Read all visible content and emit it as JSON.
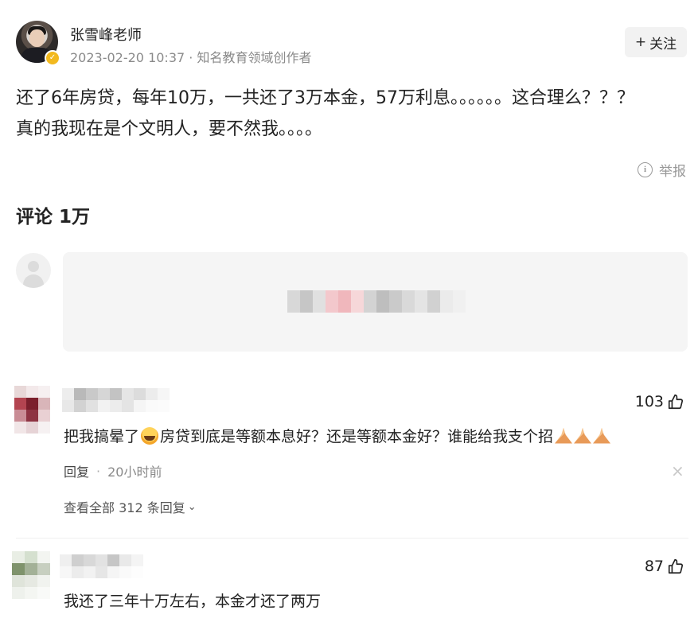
{
  "author": {
    "name": "张雪峰老师",
    "meta": "2023-02-20 10:37 · 知名教育领域创作者"
  },
  "follow_button": {
    "plus": "+",
    "label": "关注"
  },
  "post": {
    "text": "还了6年房贷，每年10万，一共还了3万本金，57万利息。。。。。。这合理么？？？\n真的我现在是个文明人，要不然我。。。。"
  },
  "report": {
    "label": "举报"
  },
  "comments": {
    "title": "评论 1万",
    "items": [
      {
        "likes": "103",
        "text_before_emoji": "把我搞晕了",
        "text_after_emoji": "房贷到底是等额本息好？还是等额本金好？谁能给我支个招",
        "reply_label": "回复",
        "separator": "·",
        "time": "20小时前",
        "view_replies": "查看全部 312 条回复"
      },
      {
        "likes": "87",
        "text": "我还了三年十万左右，本金才还了两万"
      }
    ]
  },
  "colors": {
    "pixel_avatar_1": [
      "#e8d8d8",
      "#f3e9ea",
      "#f6f0f1",
      "#b34450",
      "#7b1f2c",
      "#d9b5b9",
      "#c98c95",
      "#8e3342",
      "#e9d0d3",
      "#f1e6e7",
      "#e6d3d6",
      "#f6f1f2"
    ],
    "pixel_user_1": [
      "#ededed",
      "#b9b9b9",
      "#c9c9c9",
      "#d6d6d6",
      "#c3c3c3",
      "#e5e5e5",
      "#dcdcdc",
      "#ececec",
      "#f6f6f6",
      "#e8e8e8",
      "#d2d2d2",
      "#e1e1e1",
      "#f2f2f2",
      "#ececec",
      "#e4e4e4",
      "#f5f5f5",
      "#fafafa",
      "#fbfbfb"
    ],
    "pixel_input": [
      "#d8d8d8",
      "#c6c6c6",
      "#e0e0e0",
      "#f3c8cc",
      "#f0b7bc",
      "#f6d7d9",
      "#d3d3d3",
      "#bebebe",
      "#cacaca",
      "#d9d9d9",
      "#e4e4e4",
      "#d1d1d1",
      "#ebebeb",
      "#f0f0f0"
    ],
    "pixel_avatar_2": [
      "#e9eee5",
      "#d5e0cf",
      "#f3f5f1",
      "#7f936c",
      "#a3b197",
      "#c7cfc0",
      "#dfe4da",
      "#e6e9e2",
      "#f1f3ef",
      "#eef1ec",
      "#f4f6f2",
      "#f9faf8"
    ],
    "pixel_user_2": [
      "#efefef",
      "#cfcfcf",
      "#d8d8d8",
      "#e2e2e2",
      "#c6c6c6",
      "#e9e9e9",
      "#f4f4f4",
      "#f7f7f7",
      "#ececec",
      "#f2f2f2",
      "#e6e6e6",
      "#f5f5f5",
      "#fafafa",
      "#fdfdfd"
    ]
  }
}
